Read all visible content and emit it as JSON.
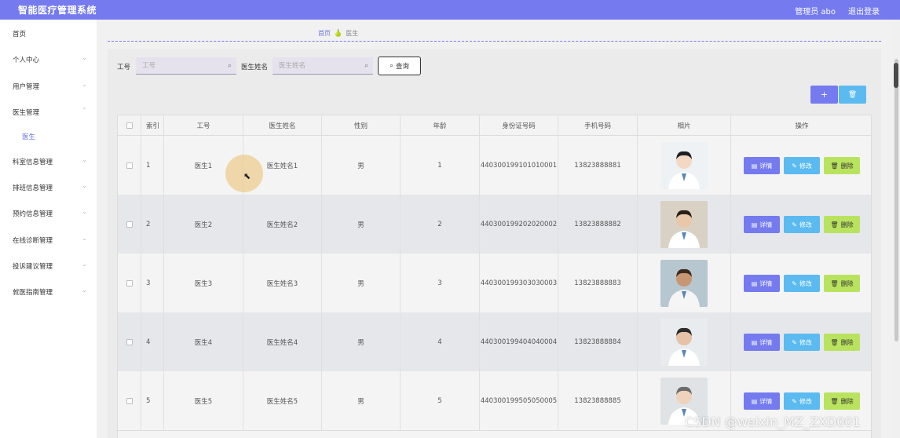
{
  "header": {
    "title": "智能医疗管理系统",
    "user": "管理员 abo",
    "logout": "退出登录"
  },
  "sidebar": {
    "items": [
      {
        "label": "首页",
        "chevron": ""
      },
      {
        "label": "个人中心",
        "chevron": "⌄"
      },
      {
        "label": "用户管理",
        "chevron": "⌄"
      },
      {
        "label": "医生管理",
        "chevron": "⌃"
      },
      {
        "label": "医生",
        "chevron": ""
      },
      {
        "label": "科室信息管理",
        "chevron": "⌄"
      },
      {
        "label": "排班信息管理",
        "chevron": "⌄"
      },
      {
        "label": "预约信息管理",
        "chevron": "⌄"
      },
      {
        "label": "在线诊断管理",
        "chevron": "⌄"
      },
      {
        "label": "投诉建议管理",
        "chevron": "⌄"
      },
      {
        "label": "就医指南管理",
        "chevron": "⌄"
      }
    ]
  },
  "breadcrumb": {
    "home": "首页",
    "current": "医生"
  },
  "search": {
    "job_label": "工号",
    "job_placeholder": "工号",
    "name_label": "医生姓名",
    "name_placeholder": "医生姓名",
    "query_label": "查询"
  },
  "toolbar": {
    "add_label": "+",
    "delete_label": "🗑"
  },
  "table": {
    "headers": [
      "",
      "索引",
      "工号",
      "医生姓名",
      "性别",
      "年龄",
      "身份证号码",
      "手机号码",
      "相片",
      "操作"
    ],
    "rows": [
      {
        "index": "1",
        "job": "医生1",
        "name": "医生姓名1",
        "gender": "男",
        "age": "1",
        "id_card": "440300199101010001",
        "phone": "13823888881"
      },
      {
        "index": "2",
        "job": "医生2",
        "name": "医生姓名2",
        "gender": "男",
        "age": "2",
        "id_card": "440300199202020002",
        "phone": "13823888882"
      },
      {
        "index": "3",
        "job": "医生3",
        "name": "医生姓名3",
        "gender": "男",
        "age": "3",
        "id_card": "440300199303030003",
        "phone": "13823888883"
      },
      {
        "index": "4",
        "job": "医生4",
        "name": "医生姓名4",
        "gender": "男",
        "age": "4",
        "id_card": "440300199404040004",
        "phone": "13823888884"
      },
      {
        "index": "5",
        "job": "医生5",
        "name": "医生姓名5",
        "gender": "男",
        "age": "5",
        "id_card": "440300199505050005",
        "phone": "13823888885"
      }
    ],
    "actions": {
      "detail": "详情",
      "edit": "修改",
      "delete": "删除"
    }
  },
  "watermark": "CSDN @weixin_MZ_ZXD001",
  "colors": {
    "primary": "#757bee",
    "info": "#5bbaf0",
    "success": "#b9e35e"
  }
}
